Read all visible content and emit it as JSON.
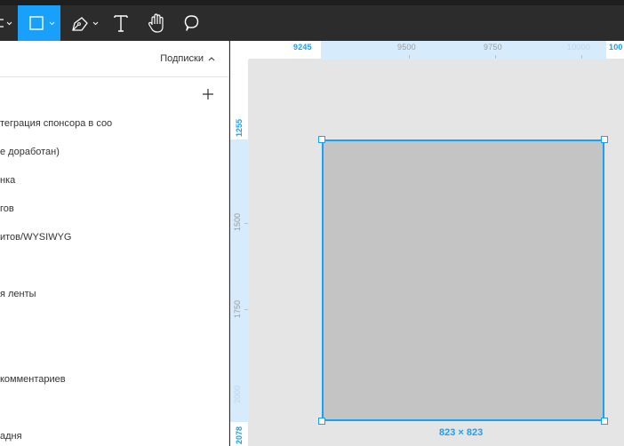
{
  "toolbar": {
    "tools": [
      {
        "name": "frame-tool",
        "partial_label": "‡"
      },
      {
        "name": "rectangle-tool",
        "active": true
      },
      {
        "name": "pen-tool"
      },
      {
        "name": "text-tool"
      },
      {
        "name": "hand-tool"
      },
      {
        "name": "comment-tool"
      }
    ],
    "accent": "#18a0fb"
  },
  "left_panel": {
    "dropdown_label": "Подписки",
    "add_icon": "plus-icon",
    "pages": [
      "теграция спонсора в соо",
      "е доработан)",
      "нка",
      "гов",
      "итов/WYSIWYG",
      "я ленты",
      "комментариев",
      "адня"
    ]
  },
  "canvas": {
    "ruler_top": {
      "labels": [
        "9245",
        "9500",
        "9750",
        "10000",
        "100"
      ]
    },
    "ruler_left": {
      "labels": [
        "1255",
        "1500",
        "1750",
        "2000",
        "2078"
      ]
    },
    "selection_size": "823 × 823",
    "shape_fill": "#c4c4c4",
    "background": "#e5e5e5"
  }
}
